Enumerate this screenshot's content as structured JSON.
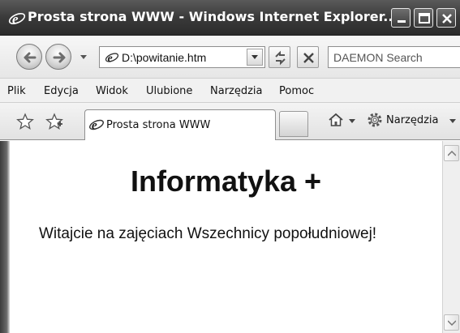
{
  "window": {
    "title": "Prosta strona WWW - Windows Internet Explorer..."
  },
  "address_bar": {
    "url": "D:\\powitanie.htm",
    "search_placeholder": "DAEMON Search"
  },
  "menu": {
    "items": [
      "Plik",
      "Edycja",
      "Widok",
      "Ulubione",
      "Narzędzia",
      "Pomoc"
    ]
  },
  "tabs": {
    "active_tab_label": "Prosta strona WWW"
  },
  "command_bar": {
    "tools_label": "Narzędzia"
  },
  "page": {
    "heading": "Informatyka +",
    "paragraph": "Witajcie na zajęciach Wszechnicy popołudniowej!"
  },
  "colors": {
    "titlebar": "#3a3a3a",
    "page_background": "#ffffff"
  },
  "icons": {
    "browser": "ie-logo-icon",
    "back": "back-arrow-icon",
    "forward": "forward-arrow-icon",
    "refresh": "refresh-icon",
    "stop": "stop-x-icon",
    "favorites": "star-icon",
    "add_favorites": "add-star-icon",
    "home": "home-icon",
    "tools": "gear-icon"
  }
}
